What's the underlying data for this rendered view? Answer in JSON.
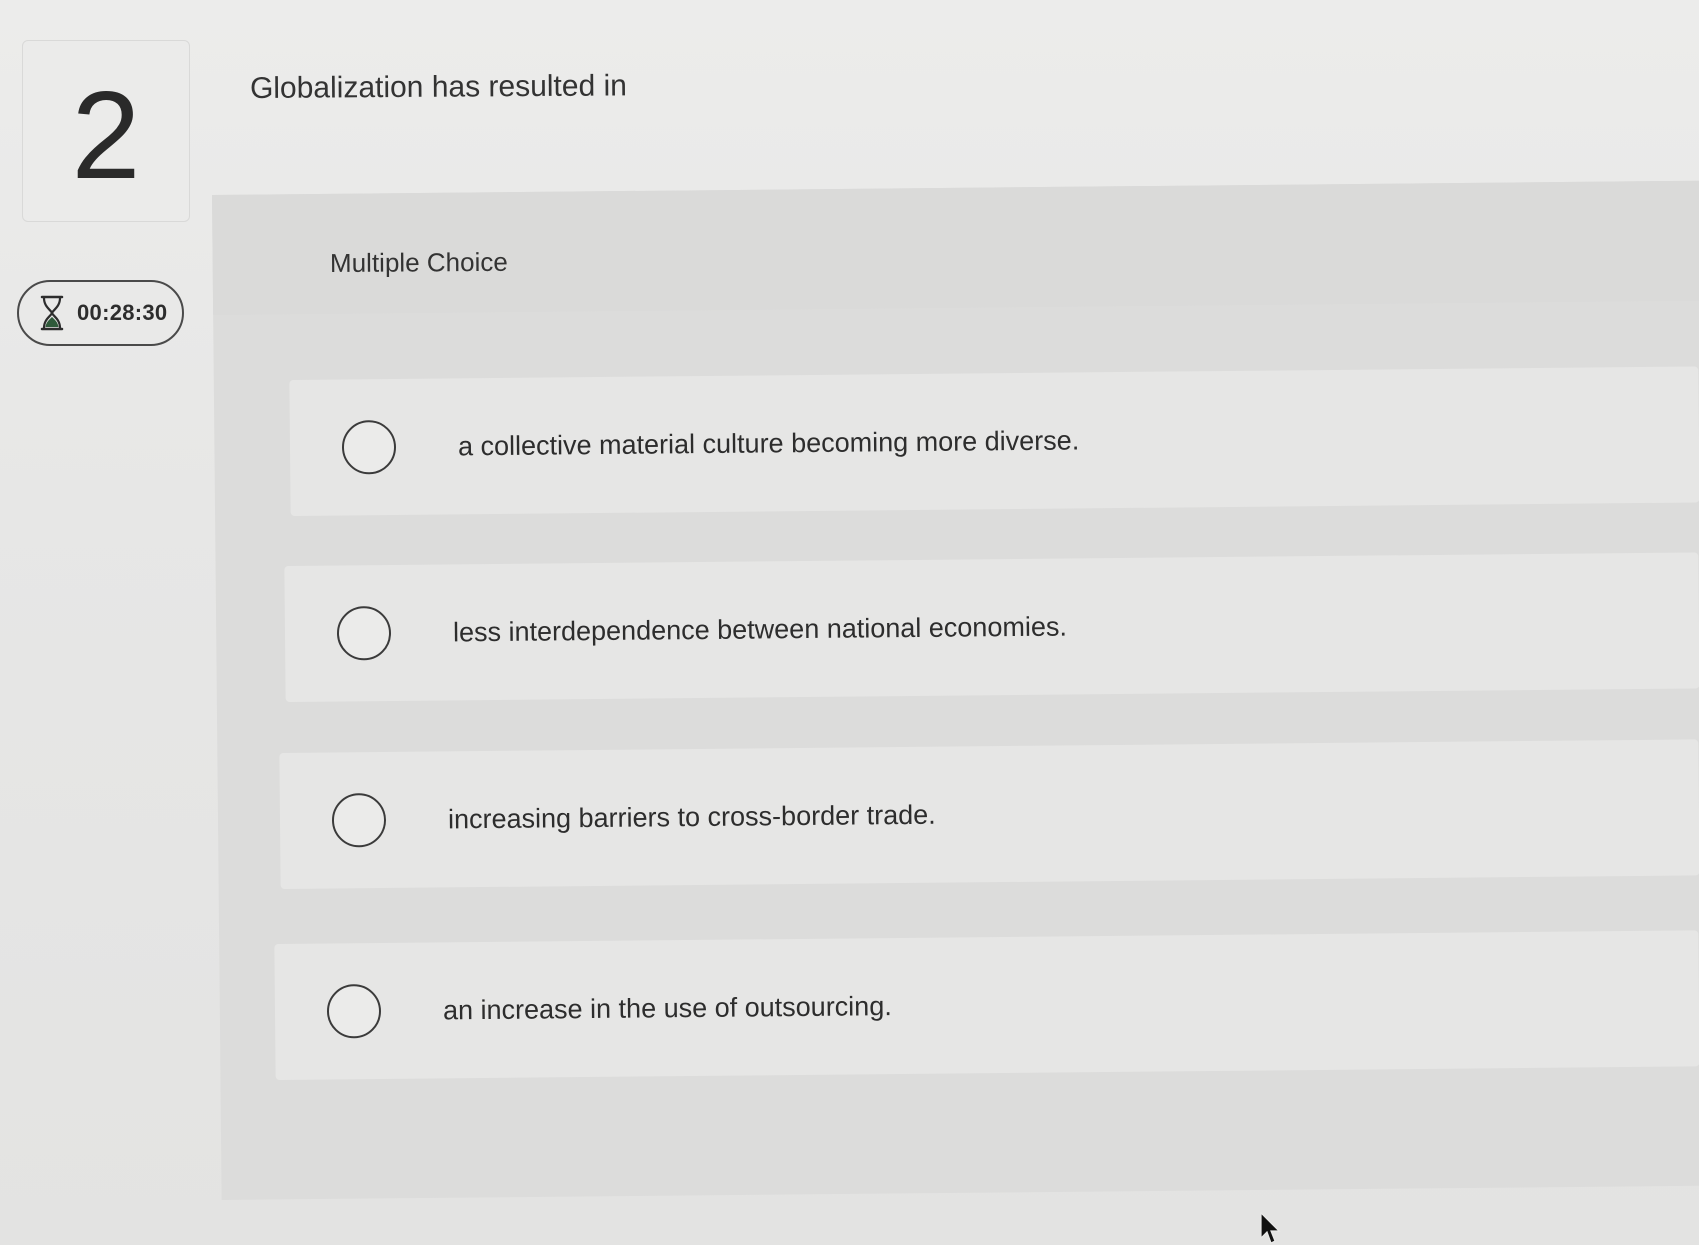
{
  "question": {
    "number": "2",
    "text": "Globalization has resulted in",
    "type_label": "Multiple Choice"
  },
  "timer": {
    "icon": "hourglass-icon",
    "value": "00:28:30"
  },
  "options": [
    {
      "label": "a collective material culture becoming more diverse.",
      "selected": false
    },
    {
      "label": "less interdependence between national economies.",
      "selected": false
    },
    {
      "label": "increasing barriers to cross-border trade.",
      "selected": false
    },
    {
      "label": "an increase in the use of outsourcing.",
      "selected": false
    }
  ],
  "colors": {
    "background": "#e9e9e8",
    "panel": "#dcdcdb",
    "option_card": "#e6e6e5",
    "text": "#2d2d2d",
    "timer_fill": "#2f5a3a"
  }
}
